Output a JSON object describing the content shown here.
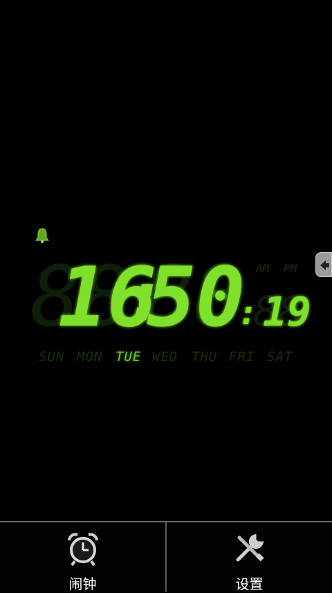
{
  "clock": {
    "hours": "16",
    "minutes": "50",
    "seconds": "19",
    "separator": ":",
    "am_label": "AM",
    "pm_label": "PM",
    "days": [
      "SUN",
      "MON",
      "TUE",
      "WED",
      "THU",
      "FRI",
      "SAT"
    ],
    "active_day": "TUE",
    "digit_color": "#7fe12a",
    "ghost_color": "#0f1e09"
  },
  "toolbar": {
    "alarm_label": "闹钟",
    "settings_label": "设置"
  },
  "icons": {
    "alarm_indicator": "bell-icon",
    "side_tab": "arrow-left-icon",
    "alarm_button": "alarm-clock-icon",
    "settings_button": "wrench-screwdriver-icon"
  }
}
